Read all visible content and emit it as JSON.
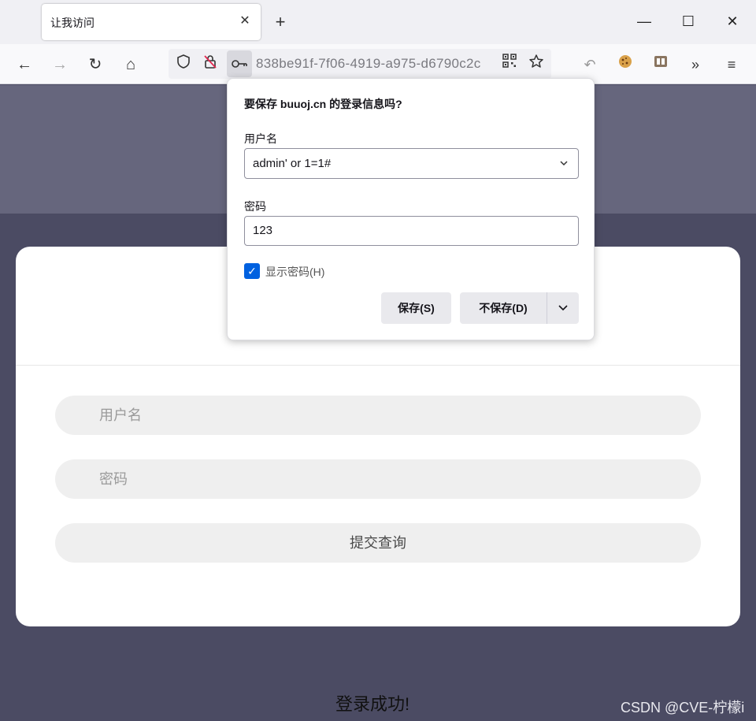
{
  "browser": {
    "tab_title": "让我访问",
    "tab_close": "✕",
    "new_tab": "+",
    "window": {
      "minimize": "—",
      "maximize": "☐",
      "close": "✕"
    },
    "nav": {
      "back": "←",
      "forward": "→",
      "reload": "↻",
      "home": "⌂"
    },
    "url_text": "838be91f-7f06-4919-a975-d6790c2c",
    "toolbar_icons": [
      "shield-icon",
      "blocked-lock-icon",
      "key-icon",
      "qr-code-icon",
      "star-icon",
      "undo-icon",
      "cookie-icon",
      "extension-icon",
      "overflow-icon",
      "menu-icon"
    ]
  },
  "popup": {
    "title": "要保存 buuoj.cn 的登录信息吗?",
    "username_label": "用户名",
    "username_value": "admin' or 1=1#",
    "password_label": "密码",
    "password_value": "123",
    "show_password_label": "显示密码(H)",
    "show_password_checked": true,
    "save_button": "保存(S)",
    "dont_save_button": "不保存(D)"
  },
  "page": {
    "username_placeholder": "用户名",
    "password_placeholder": "密码",
    "submit_label": "提交查询",
    "success_message": "登录成功!",
    "watermark": "CSDN @CVE-柠檬i"
  },
  "colors": {
    "page_top": "#66667d",
    "page_bottom": "#4b4b63",
    "checkbox_accent": "#0061e0"
  }
}
